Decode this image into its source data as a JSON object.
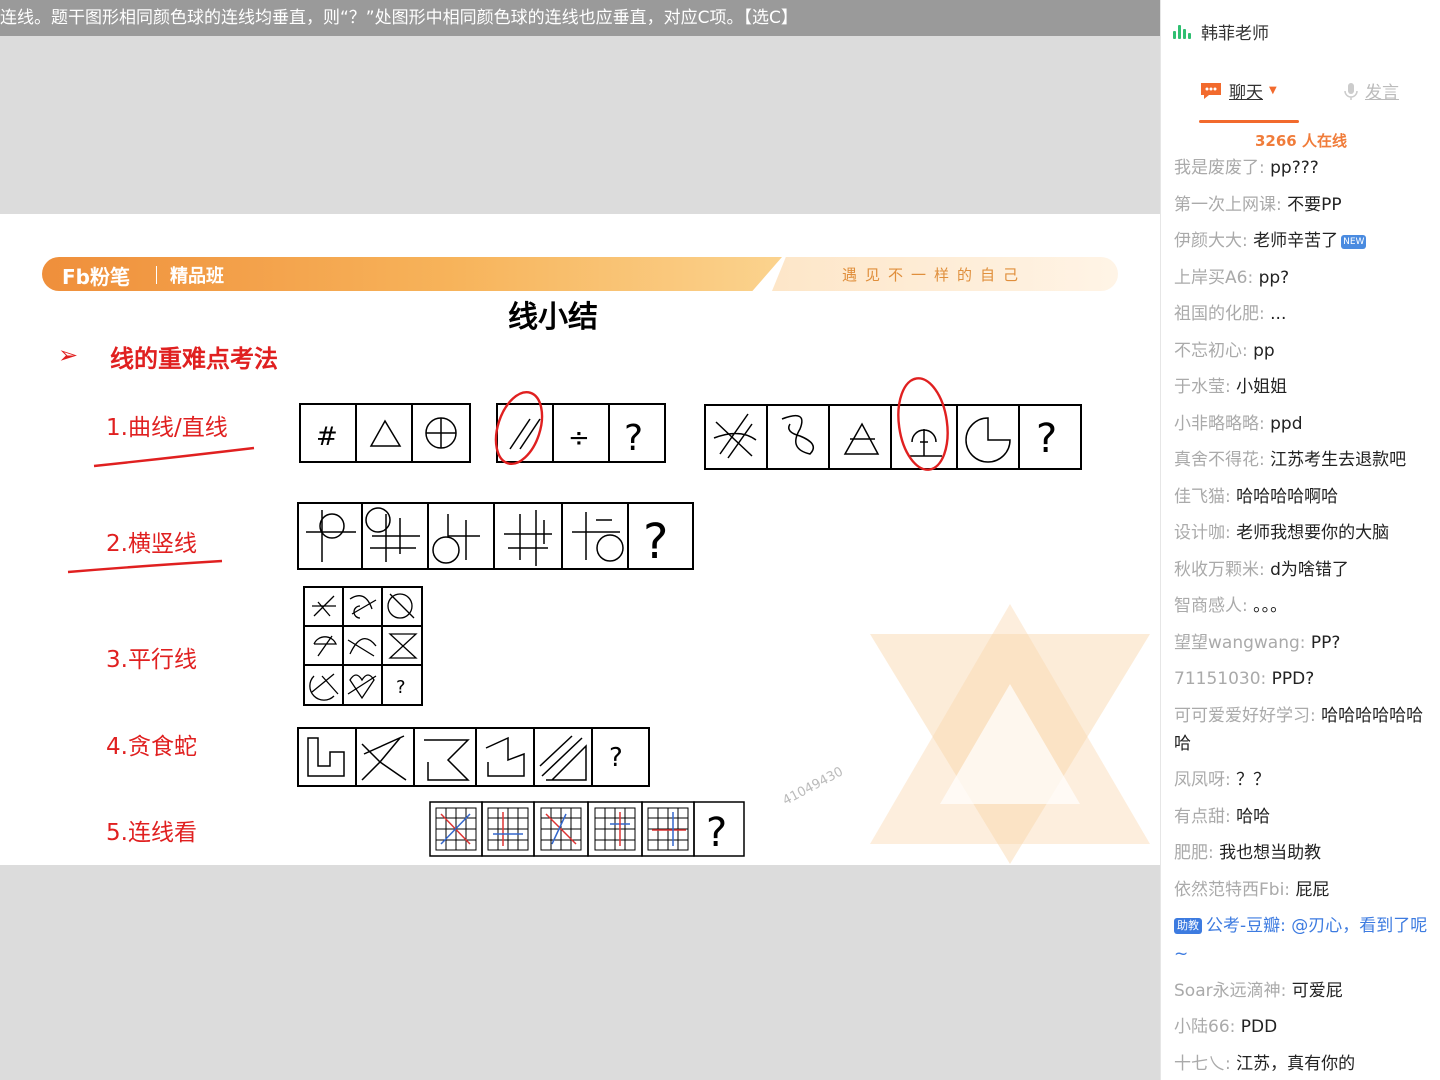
{
  "caption": "连线。题干图形相同颜色球的连线均垂直，则“？”处图形中相同颜色球的连线也应垂直，对应C项。【选C】",
  "slide": {
    "brand": "Fb粉笔",
    "brand_class": "精品班",
    "slogan": "遇见不一样的自己",
    "title": "线小结",
    "section_title": "线的重难点考法",
    "items": [
      "1.曲线/直线",
      "2.横竖线",
      "3.平行线",
      "4.贪食蛇",
      "5.连线看"
    ],
    "watermark": "41049430",
    "symbols": {
      "hash": "#",
      "divide": "÷",
      "question": "?"
    }
  },
  "sidebar": {
    "teacher": "韩菲老师",
    "tabs": {
      "chat": "聊天",
      "speak": "发言"
    },
    "online": "3266 人在线",
    "helper_badge": "助教",
    "new_badge": "NEW",
    "messages": [
      {
        "user": "我是废废了",
        "text": "pp???"
      },
      {
        "user": "第一次上网课",
        "text": "不要PP"
      },
      {
        "user": "伊颜大大",
        "text": "老师辛苦了"
      },
      {
        "user": "上岸买A6",
        "text": "pp?"
      },
      {
        "user": "祖国的化肥",
        "text": "..."
      },
      {
        "user": "不忘初心",
        "text": "pp"
      },
      {
        "user": "于水莹",
        "text": "小姐姐"
      },
      {
        "user": "小非略略略",
        "text": "ppd"
      },
      {
        "user": "真舍不得花",
        "text": "江苏考生去退款吧"
      },
      {
        "user": "佳飞猫",
        "text": "哈哈哈哈啊哈"
      },
      {
        "user": "设计咖",
        "text": "老师我想要你的大脑"
      },
      {
        "user": "秋收万颗米",
        "text": "d为啥错了"
      },
      {
        "user": "智商感人",
        "text": "。。。"
      },
      {
        "user": "望望wangwang",
        "text": "PP?"
      },
      {
        "user": "71151030",
        "text": "PPD?"
      },
      {
        "user": "可可爱爱好好学习",
        "text": "哈哈哈哈哈哈哈"
      },
      {
        "user": "凤凤呀",
        "text": "？？"
      },
      {
        "user": "有点甜",
        "text": "哈哈"
      },
      {
        "user": "肥肥",
        "text": "我也想当助教"
      },
      {
        "user": "依然范特西Fbi",
        "text": "屁屁"
      },
      {
        "user": "公考-豆瓣",
        "text": "@刃心，看到了呢~"
      },
      {
        "user": "Soar永远滴神",
        "text": "可爱屁"
      },
      {
        "user": "小陆66",
        "text": "PDD"
      },
      {
        "user": "十七乀",
        "text": "江苏，真有你的"
      }
    ]
  },
  "colors": {
    "accent": "#f26a2d",
    "red": "#e02020",
    "helper": "#3d7be0",
    "online": "#f07c3a"
  }
}
